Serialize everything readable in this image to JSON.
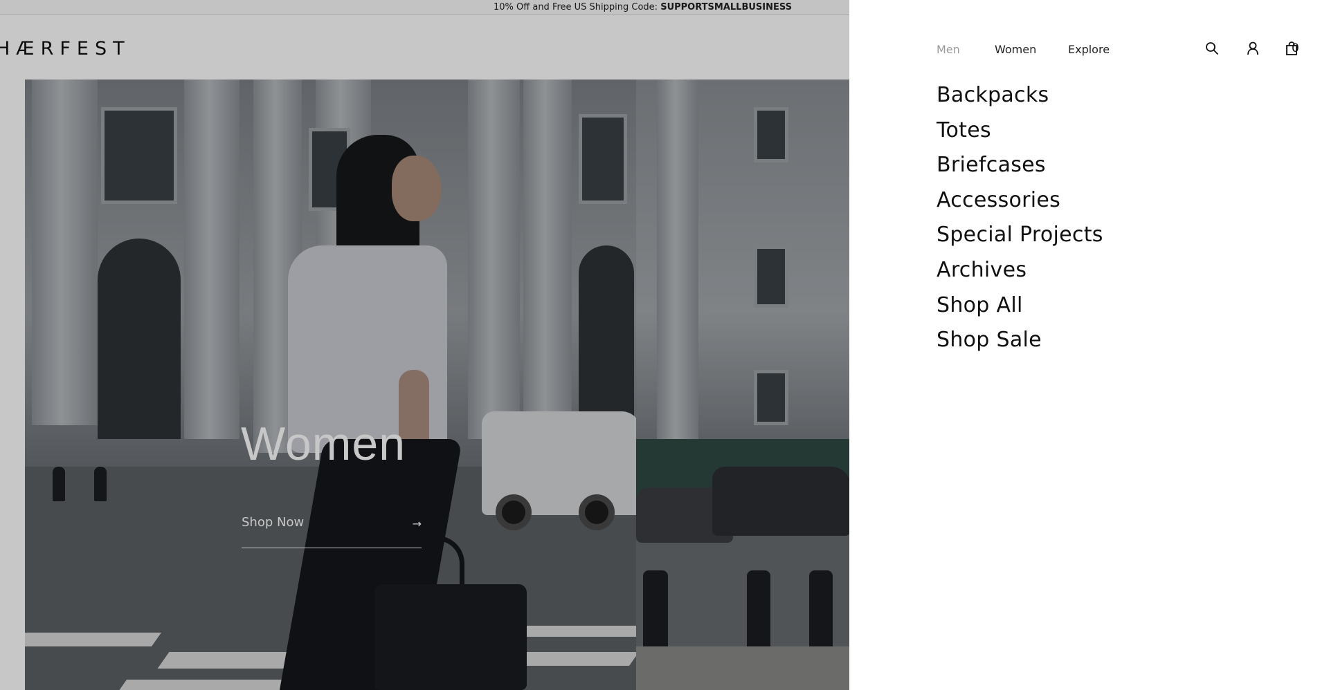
{
  "promo": {
    "text": "10% Off and Free US Shipping Code: ",
    "code": "SUPPORTSMALLBUSINESS"
  },
  "logo": "HÆRFEST",
  "hero": {
    "title": "Women",
    "cta_label": "Shop Now",
    "cta_arrow": "→"
  },
  "drawer": {
    "tabs": [
      {
        "label": "Men",
        "state": "muted"
      },
      {
        "label": "Women",
        "state": "active"
      },
      {
        "label": "Explore",
        "state": "default"
      }
    ],
    "icons": [
      "search-icon",
      "account-icon",
      "bag-icon"
    ],
    "cart_count": "0",
    "menu_items": [
      "Backpacks",
      "Totes",
      "Briefcases",
      "Accessories",
      "Special Projects",
      "Archives",
      "Shop All",
      "Shop Sale"
    ]
  },
  "colors": {
    "overlay": "rgba(0,0,0,0.22)",
    "text": "#111111",
    "muted_tab": "#9a9a9a",
    "drawer_bg": "#ffffff"
  }
}
